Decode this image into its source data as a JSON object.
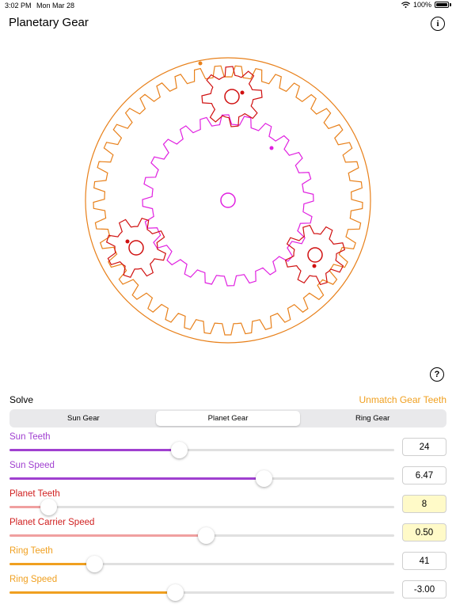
{
  "status": {
    "time": "3:02 PM",
    "date": "Mon Mar 28",
    "battery": "100%"
  },
  "nav": {
    "title": "Planetary Gear",
    "info_icon": "i"
  },
  "gears": {
    "sun": {
      "teeth": 24,
      "color": "#e020e0"
    },
    "planet": {
      "teeth": 8,
      "color": "#d01010"
    },
    "ring": {
      "teeth": 41,
      "color": "#e8801a"
    }
  },
  "help_icon": "?",
  "solve": {
    "label": "Solve",
    "unmatch_label": "Unmatch Gear Teeth"
  },
  "tabs": [
    {
      "label": "Sun Gear",
      "selected": false
    },
    {
      "label": "Planet Gear",
      "selected": true
    },
    {
      "label": "Ring Gear",
      "selected": false
    }
  ],
  "params": [
    {
      "label": "Sun Teeth",
      "value": "24",
      "color": "#a040d0",
      "fill_color": "#a040d0",
      "level": 0.44,
      "highlight": false
    },
    {
      "label": "Sun Speed",
      "value": "6.47",
      "color": "#a040d0",
      "fill_color": "#a040d0",
      "level": 0.66,
      "highlight": false
    },
    {
      "label": "Planet Teeth",
      "value": "8",
      "color": "#d02020",
      "fill_color": "#f0a0a0",
      "level": 0.1,
      "highlight": true
    },
    {
      "label": "Planet Carrier Speed",
      "value": "0.50",
      "color": "#d02020",
      "fill_color": "#f0a0a0",
      "level": 0.51,
      "highlight": true
    },
    {
      "label": "Ring Teeth",
      "value": "41",
      "color": "#f0a020",
      "fill_color": "#f0a020",
      "level": 0.22,
      "highlight": false
    },
    {
      "label": "Ring Speed",
      "value": "-3.00",
      "color": "#f0a020",
      "fill_color": "#f0a020",
      "level": 0.43,
      "highlight": false
    }
  ]
}
